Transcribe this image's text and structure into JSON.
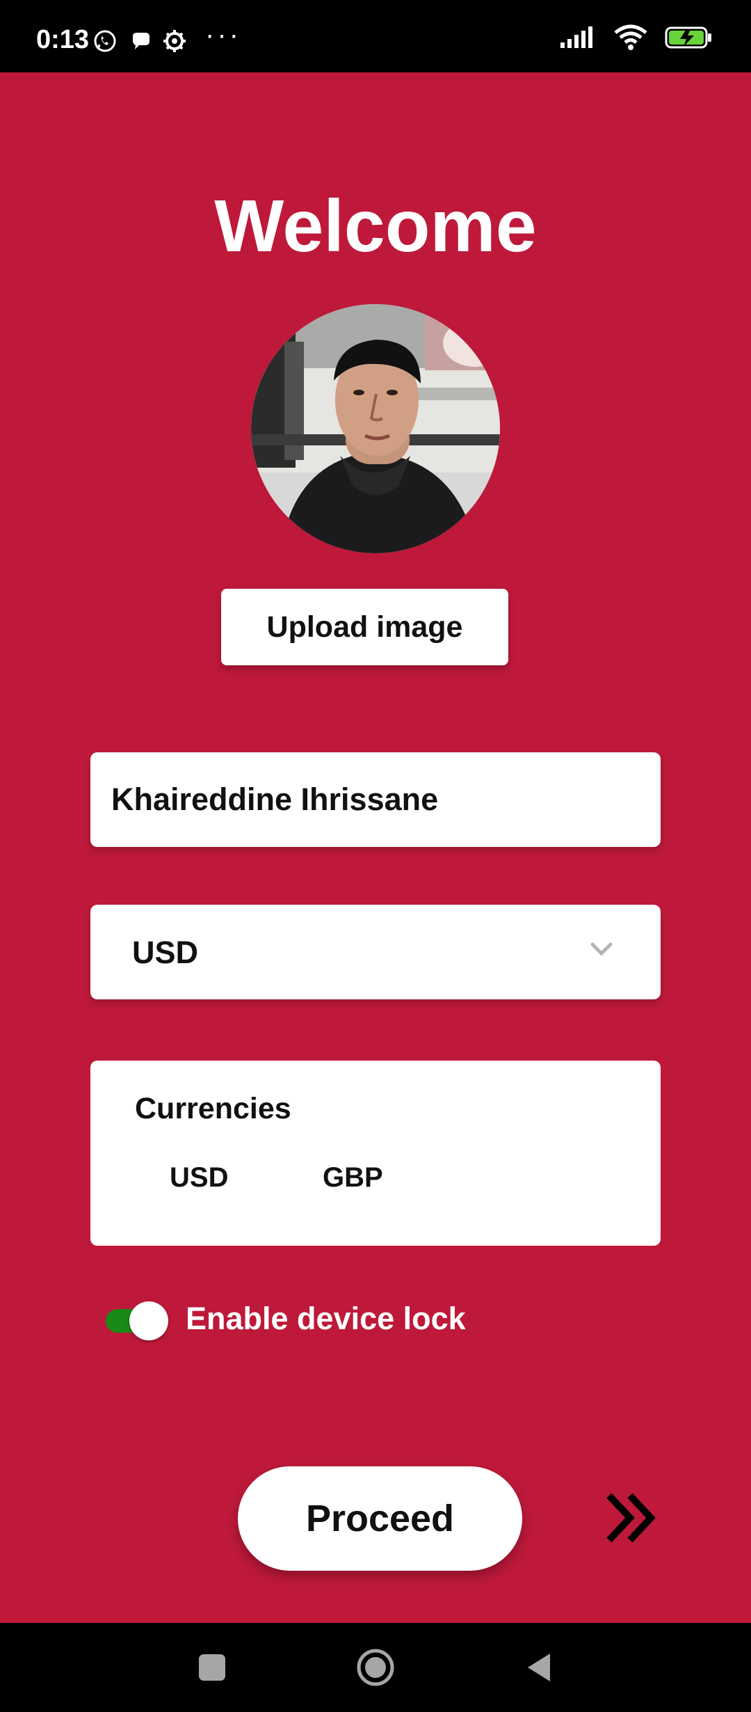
{
  "status_bar": {
    "time": "0:13",
    "dots": "···",
    "icons": [
      "whatsapp-icon",
      "chat-bubble-icon",
      "settings-gear-icon",
      "signal-icon",
      "wifi-icon",
      "battery-charging-icon"
    ]
  },
  "page": {
    "title": "Welcome",
    "upload_label": "Upload image",
    "name_value": "Khaireddine Ihrissane",
    "selected_currency": "USD",
    "currencies_title": "Currencies",
    "currency_options": [
      "USD",
      "GBP"
    ],
    "device_lock_label": "Enable device lock",
    "device_lock_enabled": true,
    "proceed_label": "Proceed"
  },
  "colors": {
    "background": "#be193a",
    "toggle_active": "#198a16",
    "surface": "#ffffff"
  },
  "navigation": {
    "buttons": [
      "recent-apps-icon",
      "home-icon",
      "back-icon"
    ]
  }
}
